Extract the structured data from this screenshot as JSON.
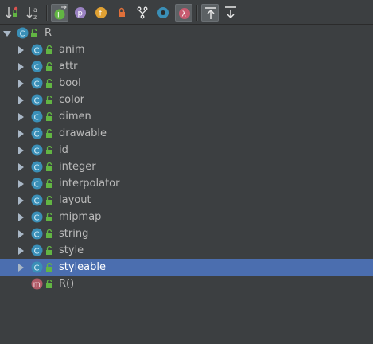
{
  "toolbar": {
    "buttons": [
      {
        "name": "sort-by-visibility-button",
        "icon": "sort-visibility-icon",
        "pressed": false
      },
      {
        "name": "sort-alphabetically-button",
        "icon": "sort-alpha-icon",
        "pressed": false
      },
      {
        "name": "show-inherited-button",
        "icon": "inherited-icon",
        "pressed": true
      },
      {
        "name": "show-properties-button",
        "icon": "property-p-icon",
        "glyph": "p",
        "pressed": false
      },
      {
        "name": "show-fields-button",
        "icon": "field-f-icon",
        "glyph": "f",
        "pressed": false
      },
      {
        "name": "show-non-public-button",
        "icon": "lock-icon",
        "pressed": false
      },
      {
        "name": "show-anonymous-classes-button",
        "icon": "fork-icon",
        "pressed": false
      },
      {
        "name": "show-interfaces-button",
        "icon": "circle-icon",
        "pressed": false
      },
      {
        "name": "show-lambdas-button",
        "icon": "lambda-icon",
        "glyph": "λ",
        "pressed": true
      },
      {
        "name": "autoscroll-to-source-button",
        "icon": "autoscroll-to-source-icon",
        "pressed": true
      },
      {
        "name": "autoscroll-from-source-button",
        "icon": "autoscroll-from-source-icon",
        "pressed": false
      }
    ]
  },
  "tree": {
    "root": {
      "label": "R",
      "icon": "class-icon",
      "glyph": "C",
      "expanded": true
    },
    "children": [
      {
        "label": "anim",
        "icon": "class-icon",
        "glyph": "C"
      },
      {
        "label": "attr",
        "icon": "class-icon",
        "glyph": "C"
      },
      {
        "label": "bool",
        "icon": "class-icon",
        "glyph": "C"
      },
      {
        "label": "color",
        "icon": "class-icon",
        "glyph": "C"
      },
      {
        "label": "dimen",
        "icon": "class-icon",
        "glyph": "C"
      },
      {
        "label": "drawable",
        "icon": "class-icon",
        "glyph": "C"
      },
      {
        "label": "id",
        "icon": "class-icon",
        "glyph": "C"
      },
      {
        "label": "integer",
        "icon": "class-icon",
        "glyph": "C"
      },
      {
        "label": "interpolator",
        "icon": "class-icon",
        "glyph": "C"
      },
      {
        "label": "layout",
        "icon": "class-icon",
        "glyph": "C"
      },
      {
        "label": "mipmap",
        "icon": "class-icon",
        "glyph": "C"
      },
      {
        "label": "string",
        "icon": "class-icon",
        "glyph": "C"
      },
      {
        "label": "style",
        "icon": "class-icon",
        "glyph": "C"
      },
      {
        "label": "styleable",
        "icon": "class-icon",
        "glyph": "C",
        "selected": true
      }
    ],
    "method": {
      "label": "R()",
      "icon": "method-icon",
      "glyph": "m"
    }
  },
  "colors": {
    "background": "#3c3f41",
    "selection": "#4b6eaf",
    "class_icon": "#3a8fb7",
    "method_icon": "#b05a67",
    "lock": "#62b543",
    "text": "#bbbbbb"
  }
}
